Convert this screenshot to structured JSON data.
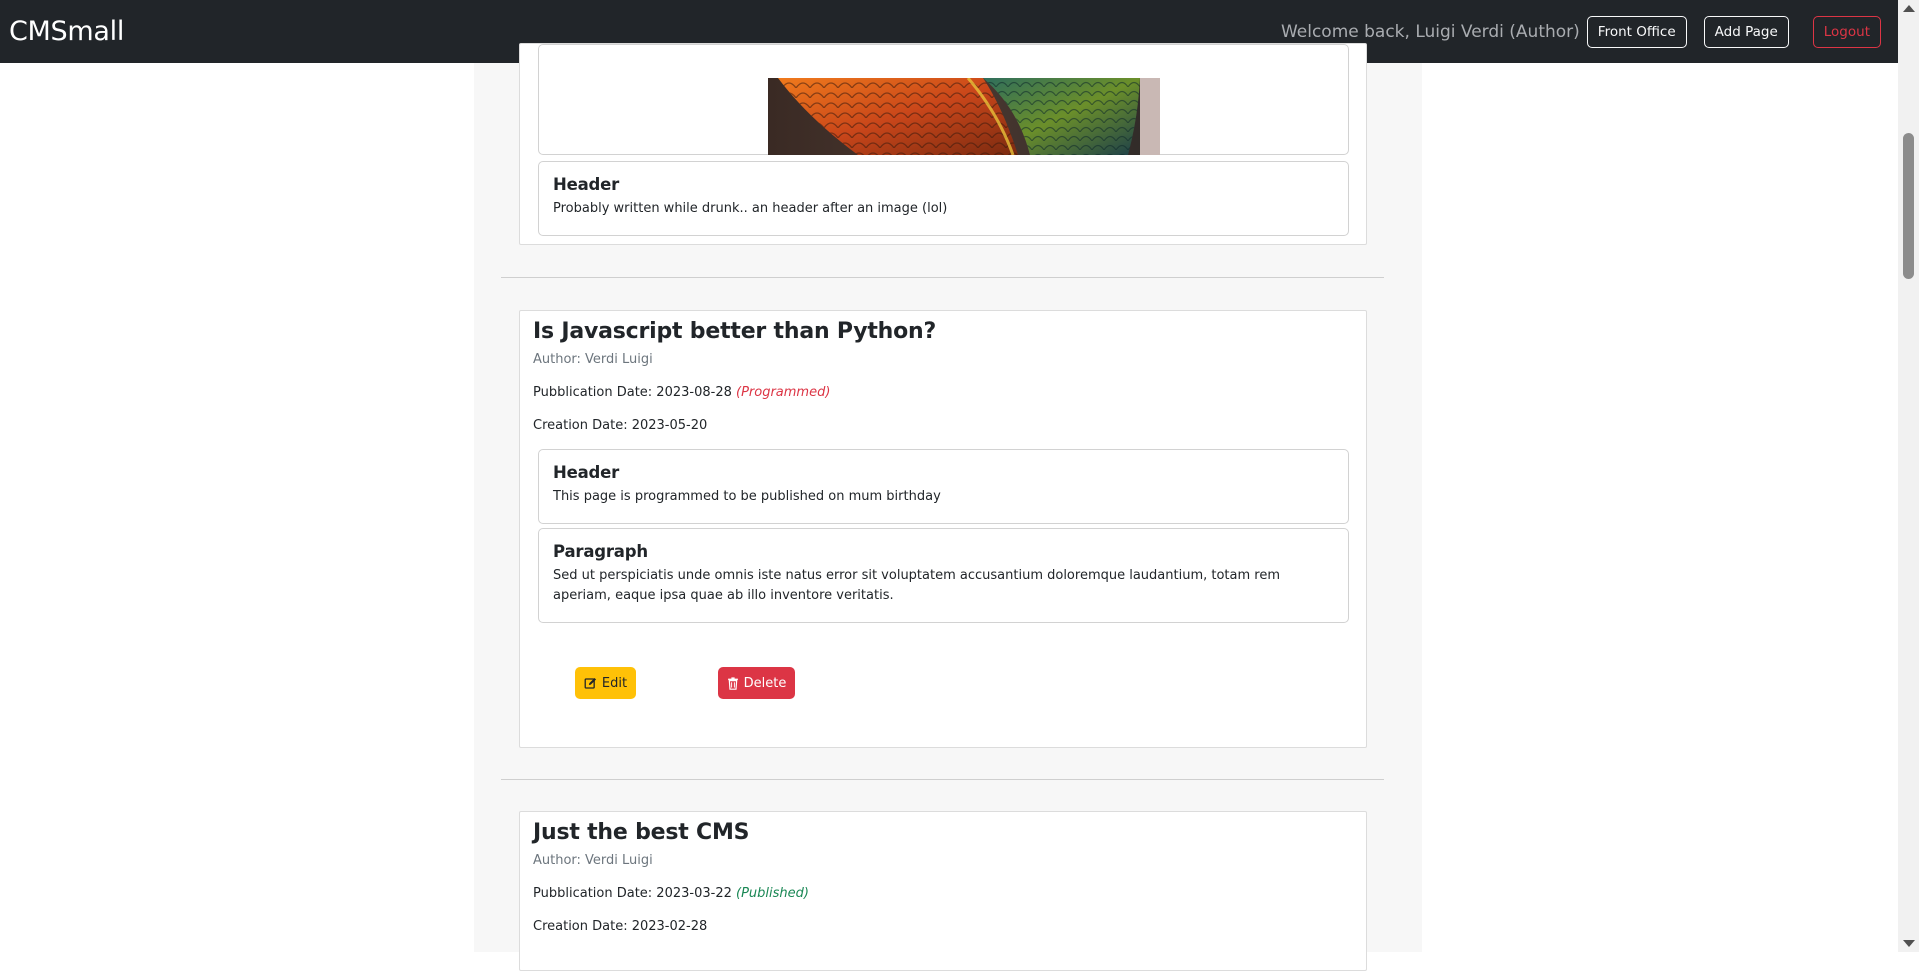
{
  "navbar": {
    "brand": "CMSmall",
    "welcome": "Welcome back, Luigi Verdi (Author)",
    "front_office_label": "Front Office",
    "add_page_label": "Add Page",
    "logout_label": "Logout"
  },
  "pages": [
    {
      "blocks": [
        {
          "type": "image"
        },
        {
          "title": "Header",
          "text": "Probably written while drunk.. an header after an image (lol)"
        }
      ]
    },
    {
      "title": "Is Javascript better than Python?",
      "author": "Author: Verdi Luigi",
      "publication_label": "Pubblication Date: 2023-08-28",
      "status": "(Programmed)",
      "creation": "Creation Date: 2023-05-20",
      "blocks": [
        {
          "title": "Header",
          "text": "This page is programmed to be published on mum birthday"
        },
        {
          "title": "Paragraph",
          "text": "Sed ut perspiciatis unde omnis iste natus error sit voluptatem accusantium doloremque laudantium, totam rem aperiam, eaque ipsa quae ab illo inventore veritatis."
        }
      ],
      "edit_label": "Edit",
      "delete_label": "Delete"
    },
    {
      "title": "Just the best CMS",
      "author": "Author: Verdi Luigi",
      "publication_label": "Pubblication Date: 2023-03-22",
      "status": "(Published)",
      "creation": "Creation Date: 2023-02-28"
    }
  ],
  "colors": {
    "navbar_bg": "#212529",
    "edit_button": "#ffc107",
    "delete_button": "#dc3545",
    "status_programmed": "#dc3545",
    "status_published": "#198754"
  }
}
